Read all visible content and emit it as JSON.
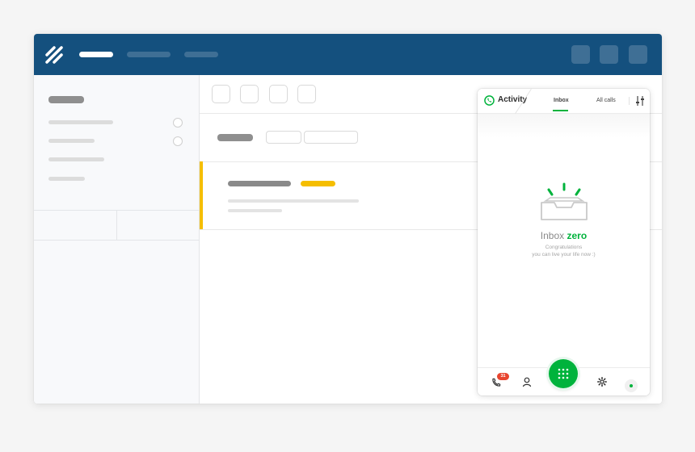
{
  "colors": {
    "topbar": "#14507e",
    "accent_green": "#00b33c",
    "row_accent": "#f5be00",
    "badge": "#e8442e"
  },
  "topbar": {
    "logo_icon": "helpscout-logo-icon",
    "nav_items": [
      "",
      "",
      ""
    ],
    "buttons": [
      "",
      "",
      ""
    ]
  },
  "phone": {
    "header": {
      "logo_icon": "phone-activity-icon",
      "title": "Activity",
      "tabs": [
        {
          "label": "Inbox",
          "active": true
        },
        {
          "label": "All calls",
          "active": false
        }
      ],
      "filter_icon": "sliders-icon"
    },
    "empty_state": {
      "illustration_icon": "empty-tray-icon",
      "title_prefix": "Inbox",
      "title_emphasis": "zero",
      "subtitle_line1": "Congratulations",
      "subtitle_line2": "you can live your life now :)"
    },
    "footer": {
      "calls_icon": "phone-icon",
      "calls_badge": "31",
      "contacts_icon": "person-icon",
      "dialpad_icon": "dialpad-icon",
      "settings_icon": "gear-icon",
      "status_icon": "online-status-icon"
    }
  }
}
